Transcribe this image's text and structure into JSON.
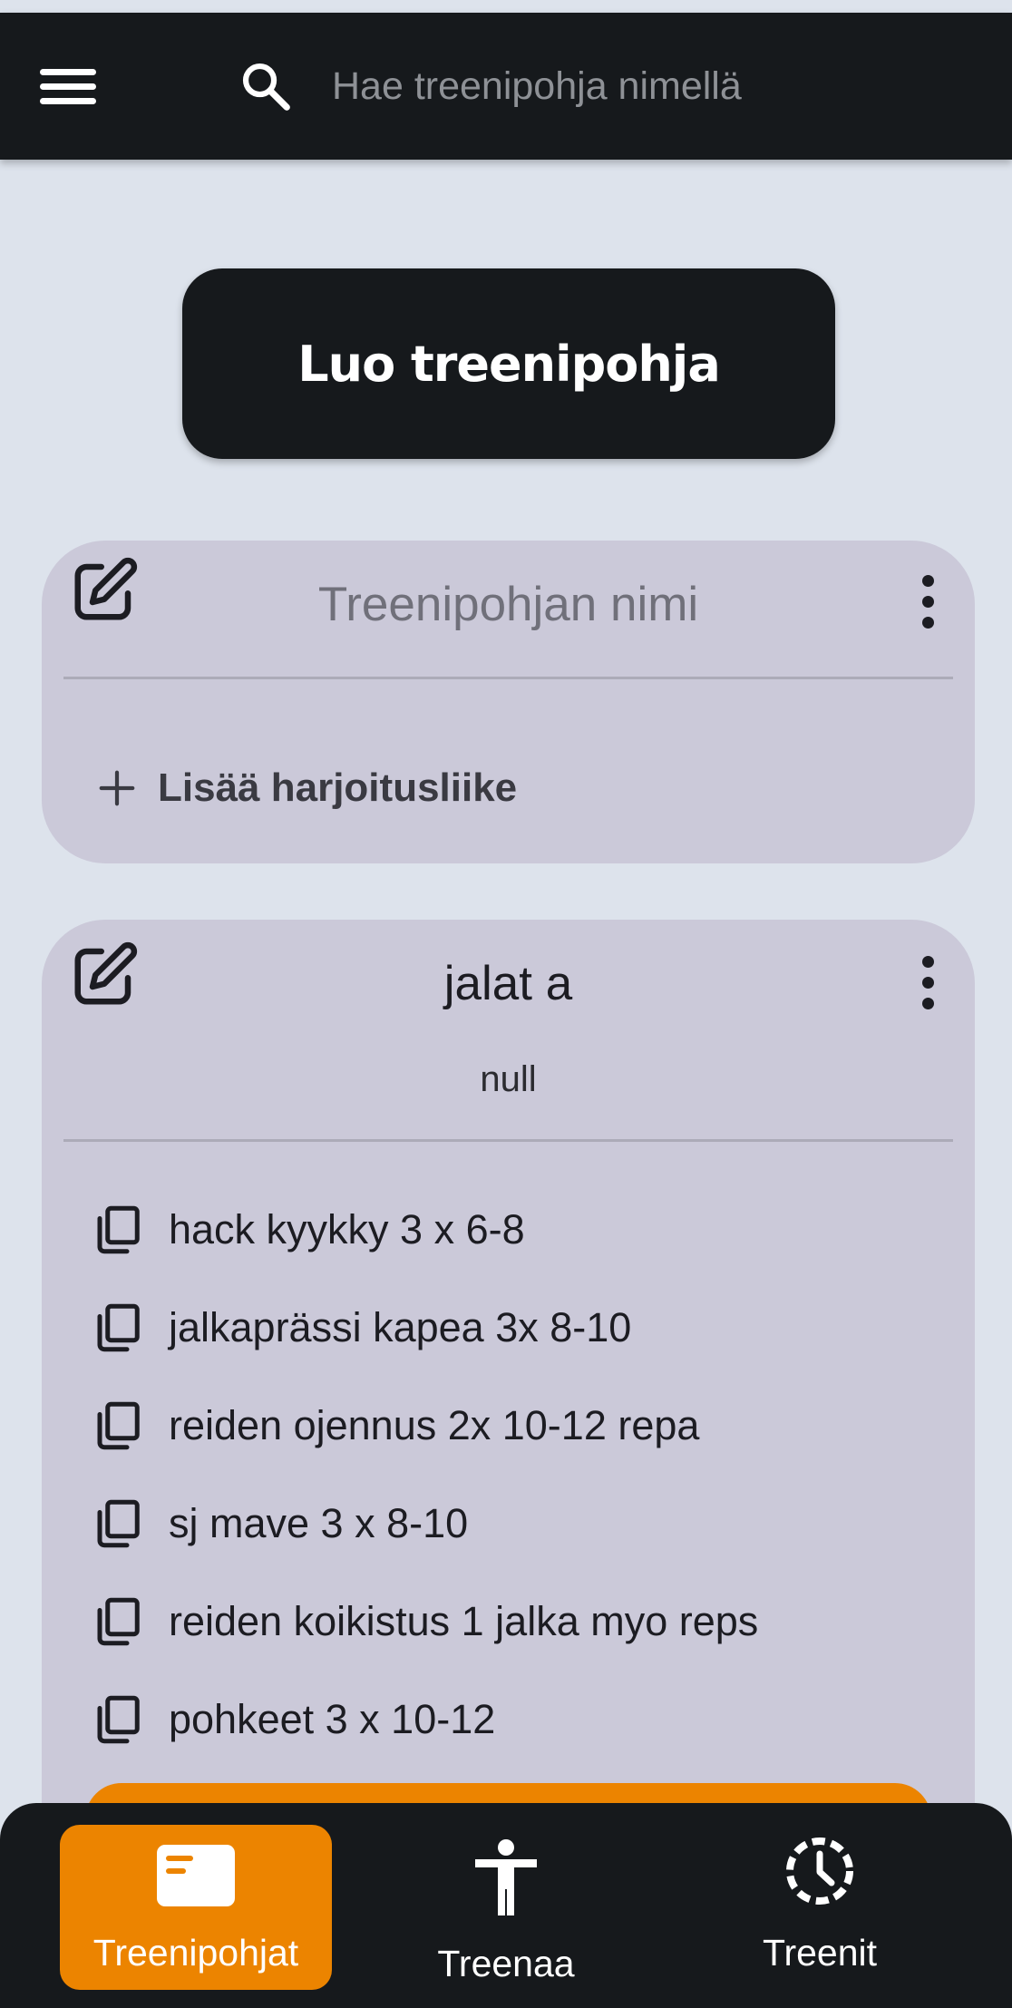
{
  "header": {
    "search_placeholder": "Hae treenipohja nimellä",
    "menu_icon": "hamburger-menu-icon",
    "search_icon": "search-icon"
  },
  "create_button": {
    "label": "Luo treenipohja"
  },
  "templates": [
    {
      "title_placeholder": "Treenipohjan nimi",
      "add_exercise_label": "Lisää harjoitusliike"
    },
    {
      "title": "jalat a",
      "description": "null",
      "exercises": [
        "hack kyykky 3 x 6-8",
        "jalkaprässi kapea 3x 8-10",
        "reiden ojennus 2x 10-12 repa",
        "sj mave 3 x 8-10",
        "reiden koikistus 1 jalka myo reps",
        "pohkeet 3 x 10-12"
      ]
    }
  ],
  "bottom_nav": [
    {
      "label": "Treenipohjat",
      "icon": "template-card-icon",
      "active": true
    },
    {
      "label": "Treenaa",
      "icon": "person-icon",
      "active": false
    },
    {
      "label": "Treenit",
      "icon": "history-clock-icon",
      "active": false
    }
  ],
  "colors": {
    "accent": "#ec8400",
    "dark": "#16191c",
    "card": "#cbc9d9",
    "background": "#dde3ec"
  }
}
